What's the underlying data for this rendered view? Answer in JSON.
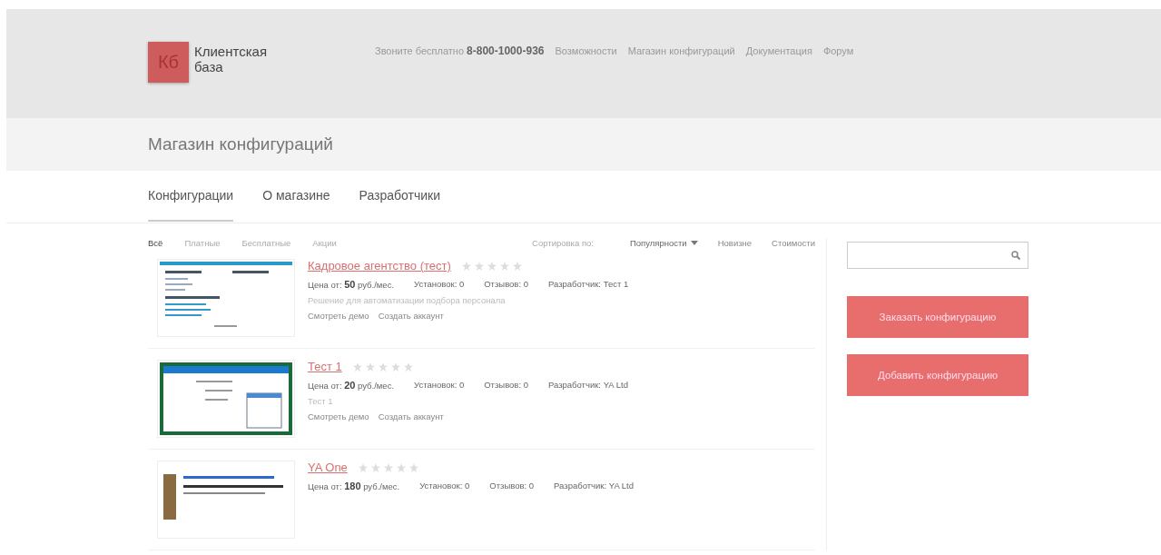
{
  "header": {
    "logo": {
      "mark": "Кб",
      "name_line_1": "Клиентская",
      "name_line_2": "база"
    },
    "phone_label": "Звоните бесплатно",
    "phone": "8-800-1000-936",
    "nav": [
      {
        "label": "Возможности"
      },
      {
        "label": "Магазин конфигураций"
      },
      {
        "label": "Документация"
      },
      {
        "label": "Форум"
      }
    ]
  },
  "page_title": "Магазин конфигураций",
  "tabs": [
    {
      "label": "Конфигурации",
      "selected": true
    },
    {
      "label": "О магазине",
      "selected": false
    },
    {
      "label": "Разработчики",
      "selected": false
    }
  ],
  "filters": [
    {
      "label": "Всё",
      "selected": true
    },
    {
      "label": "Платные",
      "selected": false
    },
    {
      "label": "Бесплатные",
      "selected": false
    },
    {
      "label": "Акции",
      "selected": false
    }
  ],
  "sort": {
    "label": "Сортировка по:",
    "options": [
      {
        "label": "Популярности",
        "selected": true
      },
      {
        "label": "Новизне",
        "selected": false
      },
      {
        "label": "Стоимости",
        "selected": false
      }
    ]
  },
  "items": [
    {
      "kind": "list",
      "title": "Кадровое агентство (тест)",
      "stars": 0,
      "price_label": "Цена от:",
      "price": "50",
      "price_unit": "руб./мес.",
      "installs": "Установок: 0",
      "reviews": "Отзывов: 0",
      "developer": "Разработчик: Тест 1",
      "description": "Решение для автоматизации подбора персонала",
      "links": [
        "Смотреть демо",
        "Создать аккаунт"
      ]
    },
    {
      "kind": "window",
      "title": "Тест 1",
      "stars": 0,
      "price_label": "Цена от:",
      "price": "20",
      "price_unit": "руб./мес.",
      "installs": "Установок: 0",
      "reviews": "Отзывов: 0",
      "developer": "Разработчик: YA Ltd",
      "description": "Тест 1",
      "links": [
        "Смотреть демо",
        "Создать аккаунт"
      ]
    },
    {
      "kind": "article",
      "title": "YA One",
      "stars": 0,
      "price_label": "Цена от:",
      "price": "180",
      "price_unit": "руб./мес.",
      "installs": "Установок: 0",
      "reviews": "Отзывов: 0",
      "developer": "Разработчик: YA Ltd"
    }
  ],
  "sidebar": {
    "buttons": [
      "Заказать конфигурацию",
      "Добавить конфигурацию"
    ]
  }
}
